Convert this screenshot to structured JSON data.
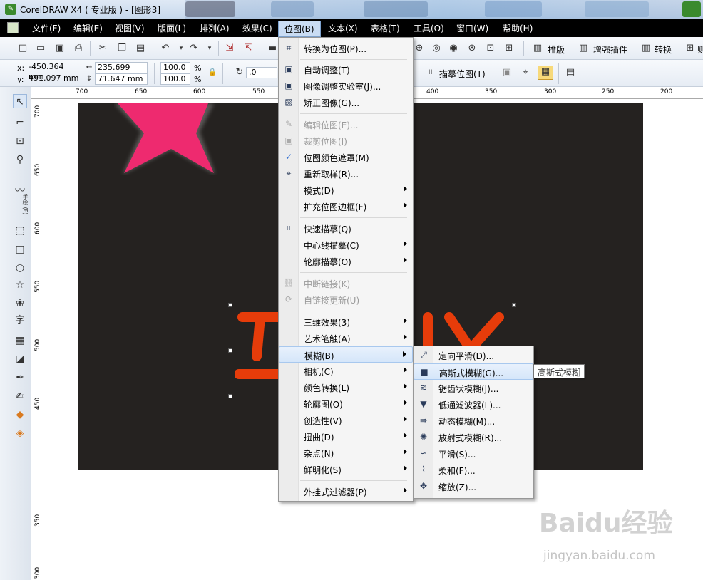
{
  "window": {
    "title": "CorelDRAW X4 ( 专业版 ) - [图形3]"
  },
  "menubar": {
    "items": [
      "文件(F)",
      "编辑(E)",
      "视图(V)",
      "版面(L)",
      "排列(A)",
      "效果(C)",
      "位图(B)",
      "文本(X)",
      "表格(T)",
      "工具(O)",
      "窗口(W)",
      "帮助(H)"
    ],
    "active": "位图(B)"
  },
  "toolbar": {
    "plugin_buttons": [
      "排版",
      "增强插件",
      "转换",
      "则"
    ]
  },
  "property_bar": {
    "x_label": "x:",
    "x_value": "-450.364 mm",
    "y_label": "y:",
    "y_value": "491.097 mm",
    "width_value": "235.699 mm",
    "height_value": "71.647 mm",
    "scale_x": "100.0",
    "scale_y": "100.0",
    "percent": "%",
    "rotation_value": ".0",
    "trace_label": "描摹位图(T)"
  },
  "ruler_top": [
    "700",
    "650",
    "600",
    "550",
    "400",
    "350",
    "300",
    "250",
    "200"
  ],
  "ruler_left": [
    "700",
    "650",
    "600",
    "550",
    "500",
    "450",
    "350",
    "300"
  ],
  "left_toolbar": {
    "freehand_label": "手绘 (F)",
    "text_tool": "字"
  },
  "bitmap_menu": {
    "items": [
      {
        "label": "转换为位图(P)...",
        "icon": "convert-bitmap-icon",
        "disabled": false,
        "submenu": false
      },
      {
        "label": "自动调整(T)",
        "icon": "auto-adjust-icon",
        "disabled": false,
        "submenu": false
      },
      {
        "label": "图像调整实验室(J)...",
        "icon": "image-lab-icon",
        "disabled": false,
        "submenu": false
      },
      {
        "label": "矫正图像(G)...",
        "icon": "straighten-icon",
        "disabled": false,
        "submenu": false
      },
      {
        "label": "编辑位图(E)...",
        "icon": "edit-bitmap-icon",
        "disabled": true,
        "submenu": false
      },
      {
        "label": "裁剪位图(I)",
        "icon": "crop-bitmap-icon",
        "disabled": true,
        "submenu": false
      },
      {
        "label": "位图颜色遮罩(M)",
        "icon": "checkmark-icon",
        "disabled": false,
        "submenu": false
      },
      {
        "label": "重新取样(R)...",
        "icon": "resample-icon",
        "disabled": false,
        "submenu": false
      },
      {
        "label": "模式(D)",
        "icon": "",
        "disabled": false,
        "submenu": true
      },
      {
        "label": "扩充位图边框(F)",
        "icon": "",
        "disabled": false,
        "submenu": true
      },
      {
        "label": "快速描摹(Q)",
        "icon": "quick-trace-icon",
        "disabled": false,
        "submenu": false
      },
      {
        "label": "中心线描摹(C)",
        "icon": "",
        "disabled": false,
        "submenu": true
      },
      {
        "label": "轮廓描摹(O)",
        "icon": "",
        "disabled": false,
        "submenu": true
      },
      {
        "label": "中断链接(K)",
        "icon": "break-link-icon",
        "disabled": true,
        "submenu": false
      },
      {
        "label": "自链接更新(U)",
        "icon": "update-link-icon",
        "disabled": true,
        "submenu": false
      },
      {
        "label": "三维效果(3)",
        "icon": "",
        "disabled": false,
        "submenu": true
      },
      {
        "label": "艺术笔触(A)",
        "icon": "",
        "disabled": false,
        "submenu": true
      },
      {
        "label": "模糊(B)",
        "icon": "",
        "disabled": false,
        "submenu": true,
        "highlighted": true
      },
      {
        "label": "相机(C)",
        "icon": "",
        "disabled": false,
        "submenu": true
      },
      {
        "label": "颜色转换(L)",
        "icon": "",
        "disabled": false,
        "submenu": true
      },
      {
        "label": "轮廓图(O)",
        "icon": "",
        "disabled": false,
        "submenu": true
      },
      {
        "label": "创造性(V)",
        "icon": "",
        "disabled": false,
        "submenu": true
      },
      {
        "label": "扭曲(D)",
        "icon": "",
        "disabled": false,
        "submenu": true
      },
      {
        "label": "杂点(N)",
        "icon": "",
        "disabled": false,
        "submenu": true
      },
      {
        "label": "鲜明化(S)",
        "icon": "",
        "disabled": false,
        "submenu": true
      },
      {
        "label": "外挂式过滤器(P)",
        "icon": "",
        "disabled": false,
        "submenu": true
      }
    ]
  },
  "blur_submenu": {
    "items": [
      {
        "label": "定向平滑(D)...",
        "icon": "directional-smooth-icon"
      },
      {
        "label": "高斯式模糊(G)...",
        "icon": "gaussian-blur-icon",
        "highlighted": true
      },
      {
        "label": "锯齿状模糊(J)...",
        "icon": "jaggy-despeckle-icon"
      },
      {
        "label": "低通滤波器(L)...",
        "icon": "low-pass-icon"
      },
      {
        "label": "动态模糊(M)...",
        "icon": "motion-blur-icon"
      },
      {
        "label": "放射式模糊(R)...",
        "icon": "radial-blur-icon"
      },
      {
        "label": "平滑(S)...",
        "icon": "smooth-icon"
      },
      {
        "label": "柔和(F)...",
        "icon": "soften-icon"
      },
      {
        "label": "缩放(Z)...",
        "icon": "zoom-blur-icon"
      }
    ]
  },
  "tooltip": "高斯式模糊",
  "watermark": {
    "brand": "Baidu经验",
    "url": "jingyan.baidu.com"
  },
  "colors": {
    "artboard": "#252220",
    "star": "#ee2a6f",
    "orange_text": "#e63c0a"
  }
}
